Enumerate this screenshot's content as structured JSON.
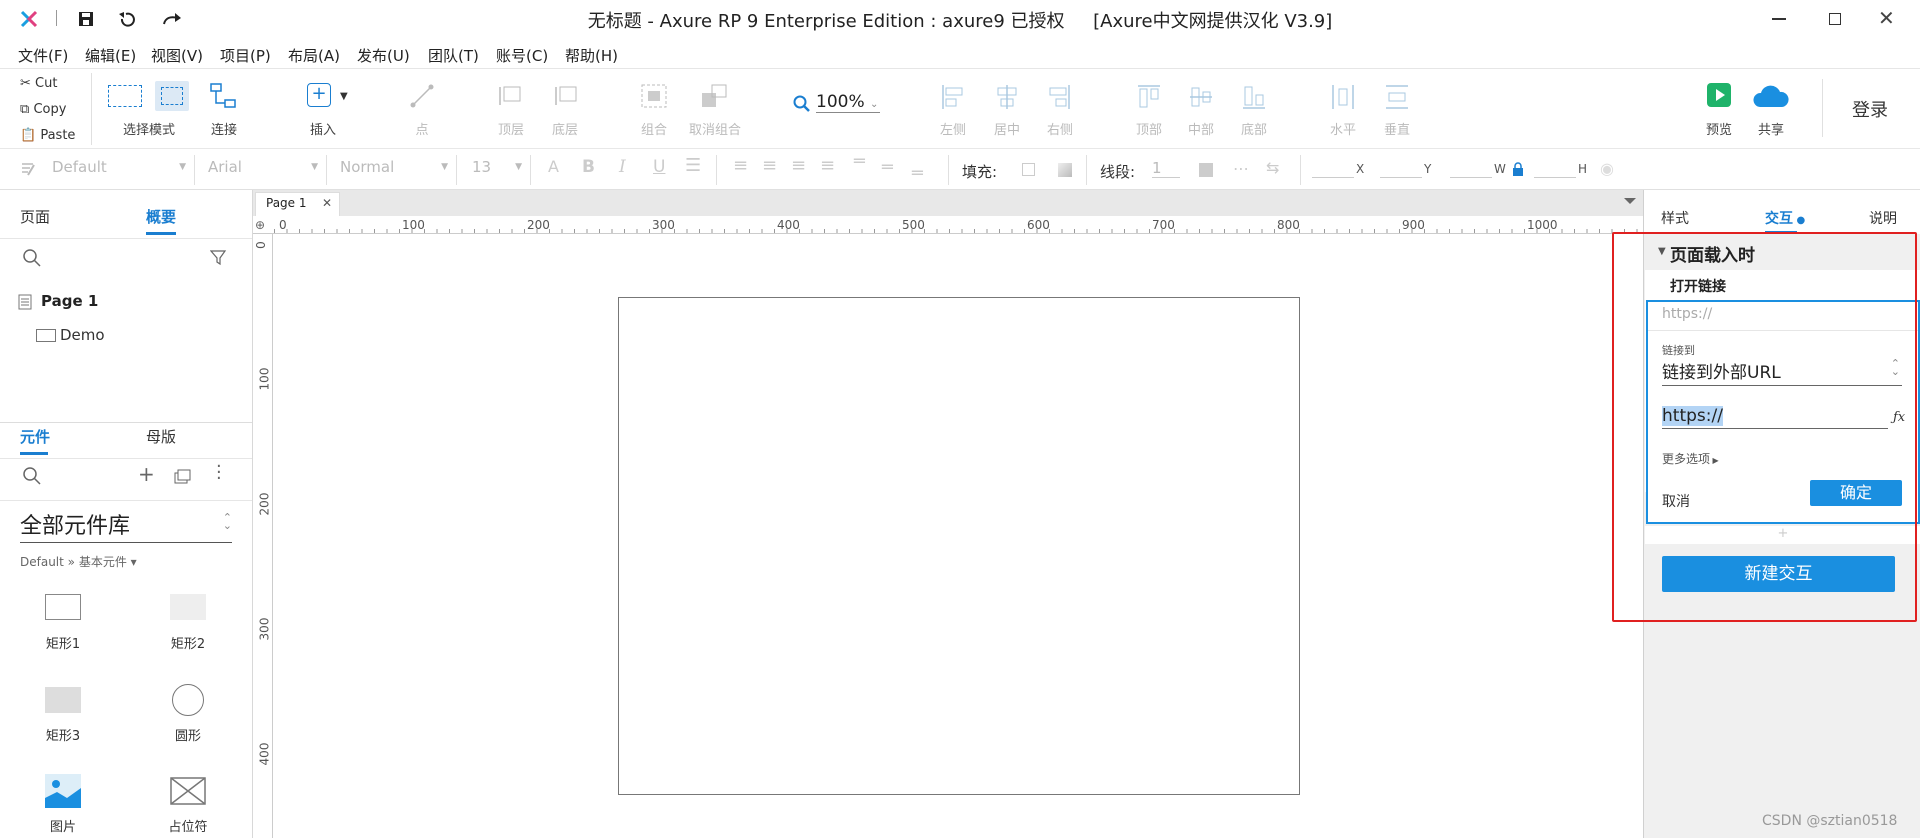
{
  "window": {
    "title": "无标题 - Axure RP 9 Enterprise Edition : axure9 已授权     [Axure中文网提供汉化 V3.9]"
  },
  "menu": [
    "文件(F)",
    "编辑(E)",
    "视图(V)",
    "项目(P)",
    "布局(A)",
    "发布(U)",
    "团队(T)",
    "账号(C)",
    "帮助(H)"
  ],
  "clipboard": {
    "cut": "Cut",
    "copy": "Copy",
    "paste": "Paste"
  },
  "toolbar": {
    "select_mode": "选择模式",
    "connect": "连接",
    "insert": "插入",
    "point": "点",
    "top_layer": "顶层",
    "bottom_layer": "底层",
    "group": "组合",
    "ungroup": "取消组合",
    "zoom": "100%",
    "align_left": "左侧",
    "align_center": "居中",
    "align_right": "右侧",
    "align_top": "顶部",
    "align_middle": "中部",
    "align_bottom": "底部",
    "dist_h": "水平",
    "dist_v": "垂直",
    "preview": "预览",
    "share": "共享",
    "login": "登录"
  },
  "stylebar": {
    "style": "Default",
    "font": "Arial",
    "weight": "Normal",
    "size": "13",
    "fill_label": "填充:",
    "stroke_label": "线段:",
    "stroke_value": "1",
    "x_label": "X",
    "y_label": "Y",
    "w_label": "W",
    "h_label": "H"
  },
  "left": {
    "tabs": {
      "pages": "页面",
      "outline": "概要"
    },
    "tree": {
      "page": "Page 1",
      "child": "Demo"
    },
    "lib_tabs": {
      "widgets": "元件",
      "masters": "母版"
    },
    "library_select": "全部元件库",
    "library_path": "Default » 基本元件 ▾",
    "widgets": [
      "矩形1",
      "矩形2",
      "矩形3",
      "圆形",
      "图片",
      "占位符"
    ]
  },
  "canvas": {
    "tab": "Page 1",
    "ruler_h": [
      "0",
      "100",
      "200",
      "300",
      "400",
      "500",
      "600",
      "700",
      "800",
      "900",
      "1000"
    ],
    "ruler_v": [
      "0",
      "100",
      "200",
      "300",
      "400"
    ]
  },
  "right": {
    "tabs": {
      "style": "样式",
      "interaction": "交互",
      "notes": "说明"
    },
    "event": "页面载入时",
    "action": "打开链接",
    "url_placeholder": "https://",
    "link_to_label": "链接到",
    "link_to_value": "链接到外部URL",
    "url_value": "https://",
    "more_options": "更多选项",
    "cancel": "取消",
    "ok": "确定",
    "new_interaction": "新建交互"
  },
  "watermark": "CSDN @sztian0518",
  "colors": {
    "accent": "#1a8fe0",
    "highlight": "#e02020"
  }
}
